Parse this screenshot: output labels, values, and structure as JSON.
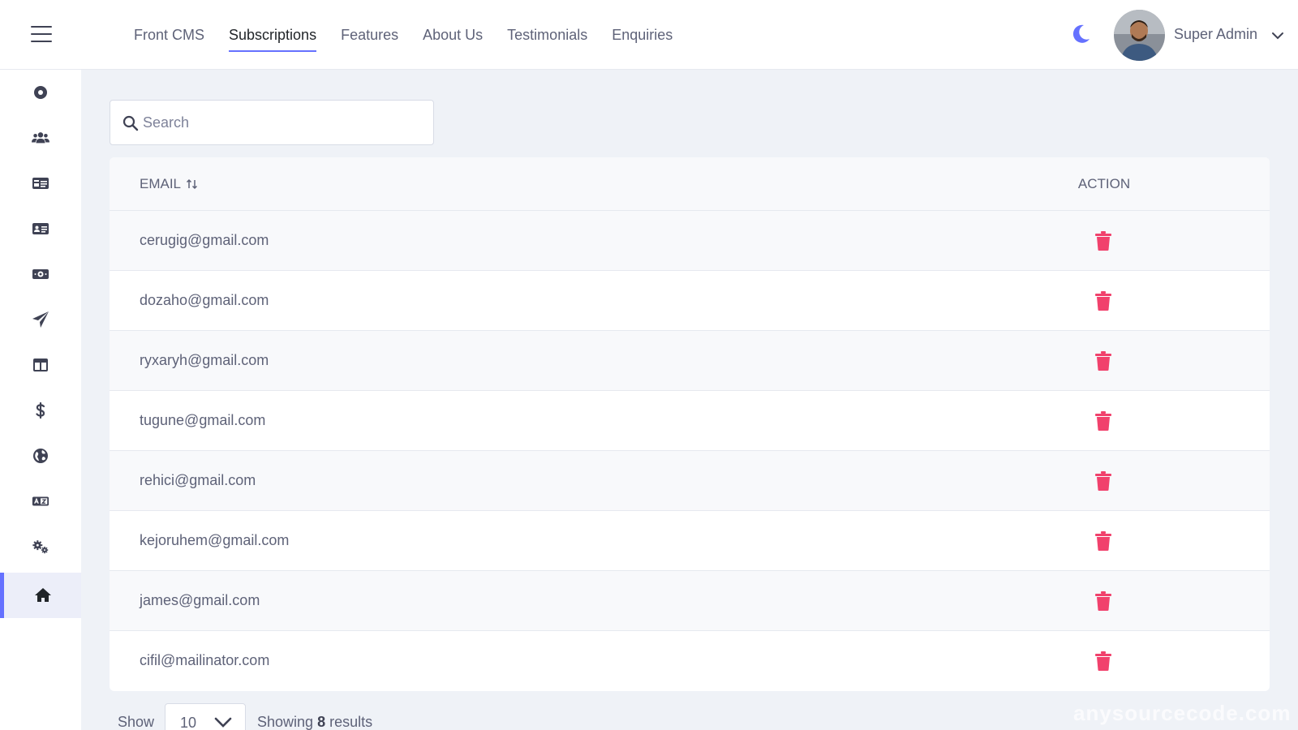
{
  "header": {
    "tabs": [
      {
        "label": "Front CMS",
        "active": false
      },
      {
        "label": "Subscriptions",
        "active": true
      },
      {
        "label": "Features",
        "active": false
      },
      {
        "label": "About Us",
        "active": false
      },
      {
        "label": "Testimonials",
        "active": false
      },
      {
        "label": "Enquiries",
        "active": false
      }
    ],
    "theme_icon": "moon-icon",
    "user_name": "Super Admin"
  },
  "sidebar": {
    "items": [
      {
        "icon": "dashboard-circle-icon"
      },
      {
        "icon": "users-icon"
      },
      {
        "icon": "id-card-icon"
      },
      {
        "icon": "address-card-icon"
      },
      {
        "icon": "money-bill-icon"
      },
      {
        "icon": "paper-plane-icon"
      },
      {
        "icon": "table-layout-icon"
      },
      {
        "icon": "dollar-icon"
      },
      {
        "icon": "globe-icon"
      },
      {
        "icon": "language-icon"
      },
      {
        "icon": "cogs-icon"
      },
      {
        "icon": "home-icon",
        "active": true
      }
    ],
    "active_color": "#6571ff"
  },
  "search": {
    "placeholder": "Search"
  },
  "table": {
    "columns": {
      "email": "EMAIL",
      "action": "ACTION"
    },
    "rows": [
      {
        "email": "cerugig@gmail.com"
      },
      {
        "email": "dozaho@gmail.com"
      },
      {
        "email": "ryxaryh@gmail.com"
      },
      {
        "email": "tugune@gmail.com"
      },
      {
        "email": "rehici@gmail.com"
      },
      {
        "email": "kejoruhem@gmail.com"
      },
      {
        "email": "james@gmail.com"
      },
      {
        "email": "cifil@mailinator.com"
      }
    ],
    "delete_color": "#f1416c"
  },
  "footer": {
    "show_label": "Show",
    "per_page": "10",
    "results_prefix": "Showing",
    "results_count": "8",
    "results_suffix": "results"
  },
  "watermark": "anysourcecode.com"
}
